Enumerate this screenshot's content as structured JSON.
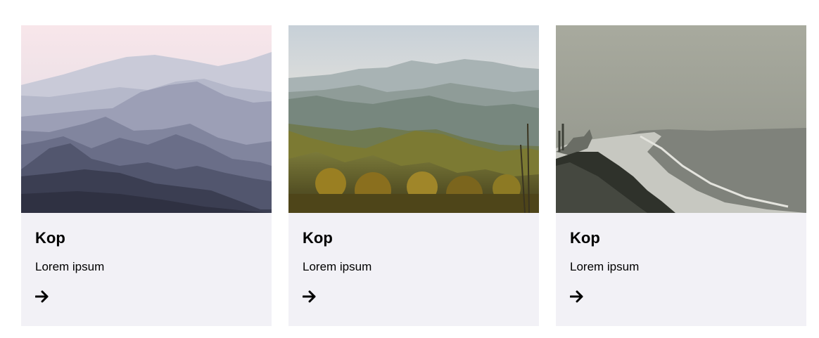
{
  "cards": [
    {
      "title": "Kop",
      "text": "Lorem ipsum",
      "image_icon": "mountains-misty-watercolor-image",
      "arrow_icon": "arrow-right-icon",
      "palette": [
        "#f5e3e6",
        "#b8bbcc",
        "#8e92ab",
        "#6b6f89",
        "#4b4f66",
        "#35384b"
      ]
    },
    {
      "title": "Kop",
      "text": "Lorem ipsum",
      "image_icon": "mountains-autumn-forest-image",
      "arrow_icon": "arrow-right-icon",
      "palette": [
        "#d9dde0",
        "#9eaaa4",
        "#7f8c7e",
        "#6e7651",
        "#8f7a24",
        "#4f4a1e"
      ]
    },
    {
      "title": "Kop",
      "text": "Lorem ipsum",
      "image_icon": "foggy-beach-coast-image",
      "arrow_icon": "arrow-right-icon",
      "palette": [
        "#a9ab9f",
        "#8d9089",
        "#7d8079",
        "#c9c9c2",
        "#3a3c36",
        "#5a5d55"
      ]
    }
  ]
}
